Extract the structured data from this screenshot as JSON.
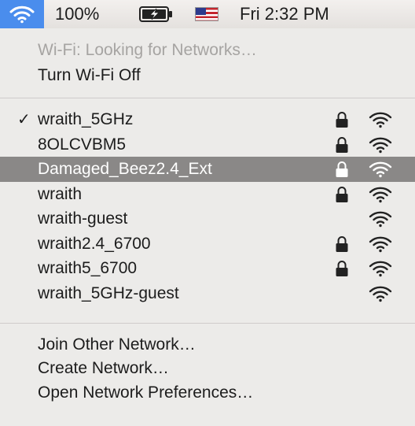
{
  "menubar": {
    "wifi_icon": "wifi-icon",
    "battery_percent": "100%",
    "battery_icon": "battery-charging-icon",
    "flag_icon": "us-flag-icon",
    "clock": "Fri 2:32 PM"
  },
  "menu": {
    "status": "Wi-Fi: Looking for Networks…",
    "toggle_label": "Turn Wi-Fi Off",
    "networks": [
      {
        "name": "wraith_5GHz",
        "checked": "✓",
        "locked": true,
        "selected": false
      },
      {
        "name": "8OLCVBM5",
        "checked": "",
        "locked": true,
        "selected": false
      },
      {
        "name": "Damaged_Beez2.4_Ext",
        "checked": "",
        "locked": true,
        "selected": true
      },
      {
        "name": "wraith",
        "checked": "",
        "locked": true,
        "selected": false
      },
      {
        "name": "wraith-guest",
        "checked": "",
        "locked": false,
        "selected": false
      },
      {
        "name": "wraith2.4_6700",
        "checked": "",
        "locked": true,
        "selected": false
      },
      {
        "name": "wraith5_6700",
        "checked": "",
        "locked": true,
        "selected": false
      },
      {
        "name": "wraith_5GHz-guest",
        "checked": "",
        "locked": false,
        "selected": false
      }
    ],
    "actions": {
      "join_other": "Join Other Network…",
      "create": "Create Network…",
      "open_prefs": "Open Network Preferences…"
    }
  },
  "colors": {
    "menubar_highlight": "#4a8ded",
    "row_highlight": "#8a8887",
    "disabled_text": "#a6a4a2"
  }
}
